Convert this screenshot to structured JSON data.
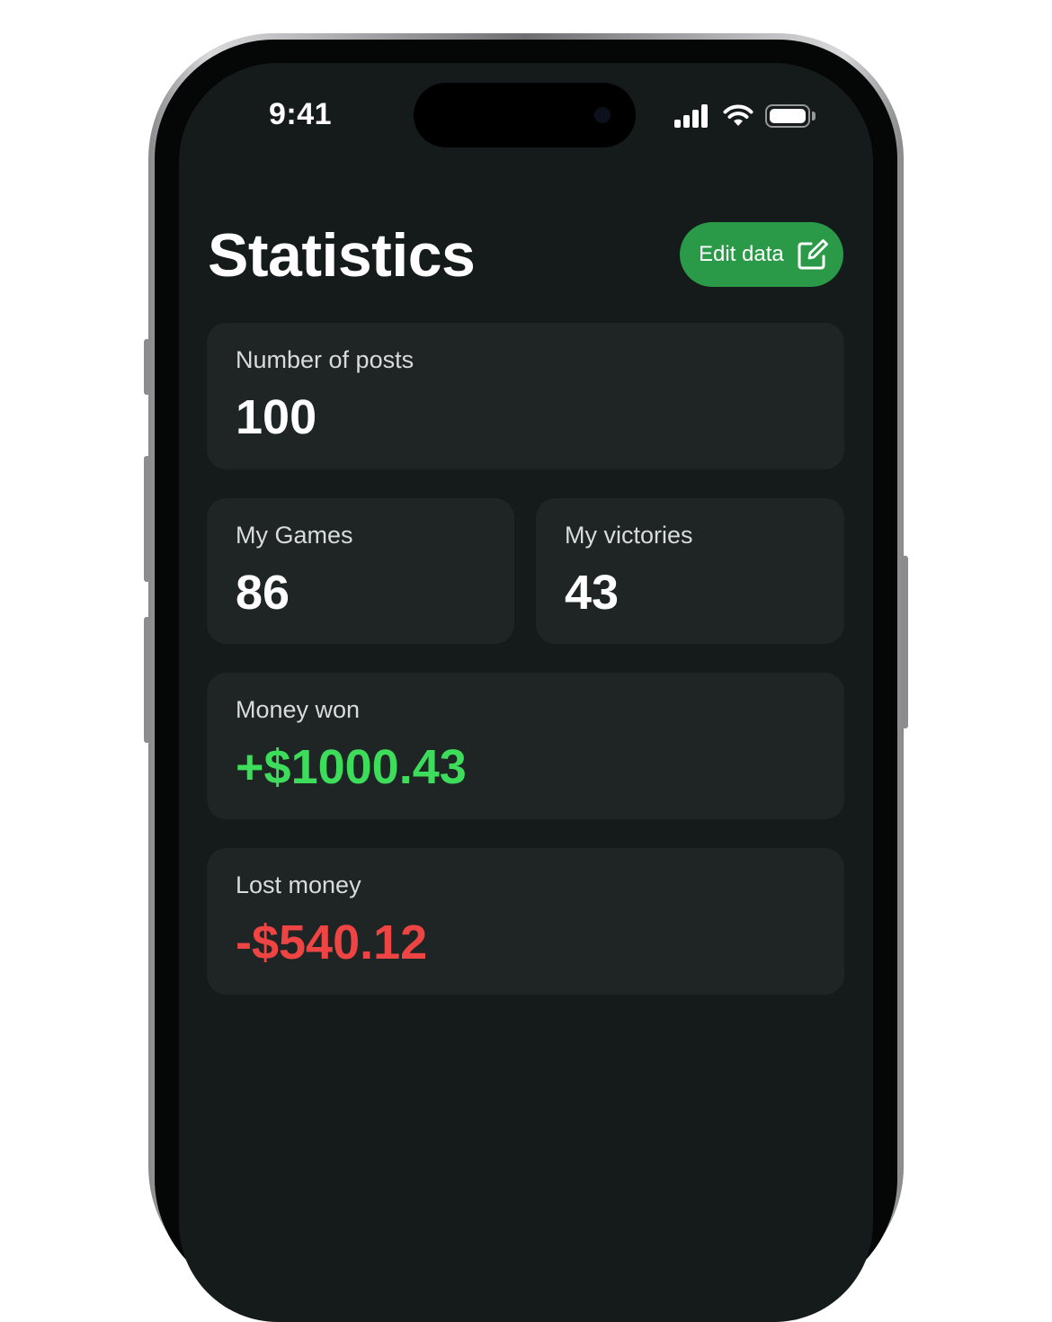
{
  "status_bar": {
    "time": "9:41",
    "icons": [
      "signal-icon",
      "wifi-icon",
      "battery-icon"
    ]
  },
  "header": {
    "title": "Statistics",
    "edit_button_label": "Edit data",
    "edit_icon": "edit-icon"
  },
  "stats": {
    "posts": {
      "label": "Number of posts",
      "value": "100"
    },
    "games": {
      "label": "My Games",
      "value": "86"
    },
    "victories": {
      "label": "My victories",
      "value": "43"
    },
    "money_won": {
      "label": "Money won",
      "value": "+$1000.43"
    },
    "money_lost": {
      "label": "Lost money",
      "value": "-$540.12"
    }
  },
  "colors": {
    "background": "#151b1a",
    "card": "#1e2524",
    "accent_button": "#2a9a48",
    "positive": "#3ddc5a",
    "negative": "#ef4444"
  }
}
